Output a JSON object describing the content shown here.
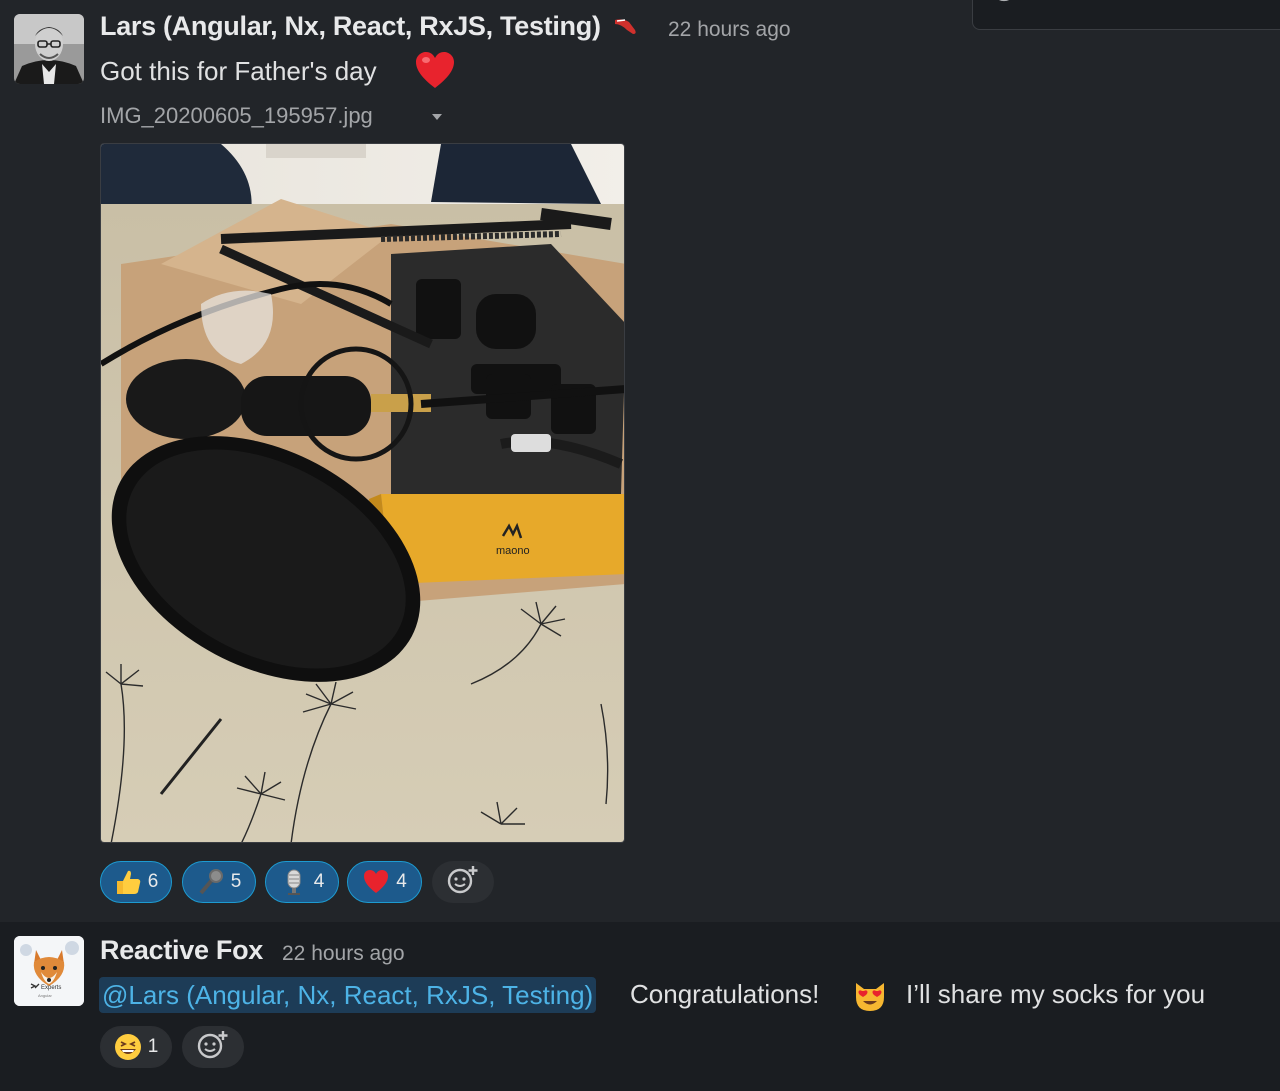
{
  "messages": [
    {
      "author": "Lars (Angular, Nx, React, RxJS, Testing)",
      "timestamp": "22 hours ago",
      "text": "Got this for Father's day",
      "attachment": {
        "file_name": "IMG_20200605_195957.jpg",
        "brand_text": "maono"
      },
      "reactions": [
        {
          "emoji": "thumbs-up",
          "count": "6"
        },
        {
          "emoji": "microphone",
          "count": "5"
        },
        {
          "emoji": "studio-microphone",
          "count": "4"
        },
        {
          "emoji": "red-heart",
          "count": "4"
        }
      ]
    },
    {
      "author": "Reactive Fox",
      "timestamp": "22 hours ago",
      "mention": "@Lars (Angular, Nx, React, RxJS, Testing)",
      "text_before_emoji": "Congratulations!",
      "text_after_emoji": "I’ll share my socks for you",
      "avatar_text": "Experts",
      "avatar_subtext": "Angular",
      "reactions": [
        {
          "emoji": "grinning-squinting-face",
          "count": "1"
        }
      ]
    }
  ],
  "colors": {
    "background": "#1a1d21",
    "hover_background": "#222529",
    "reaction_active_bg": "#1d5a8c",
    "reaction_active_border": "#1d9bd1",
    "mention_text": "#4db3e6"
  }
}
